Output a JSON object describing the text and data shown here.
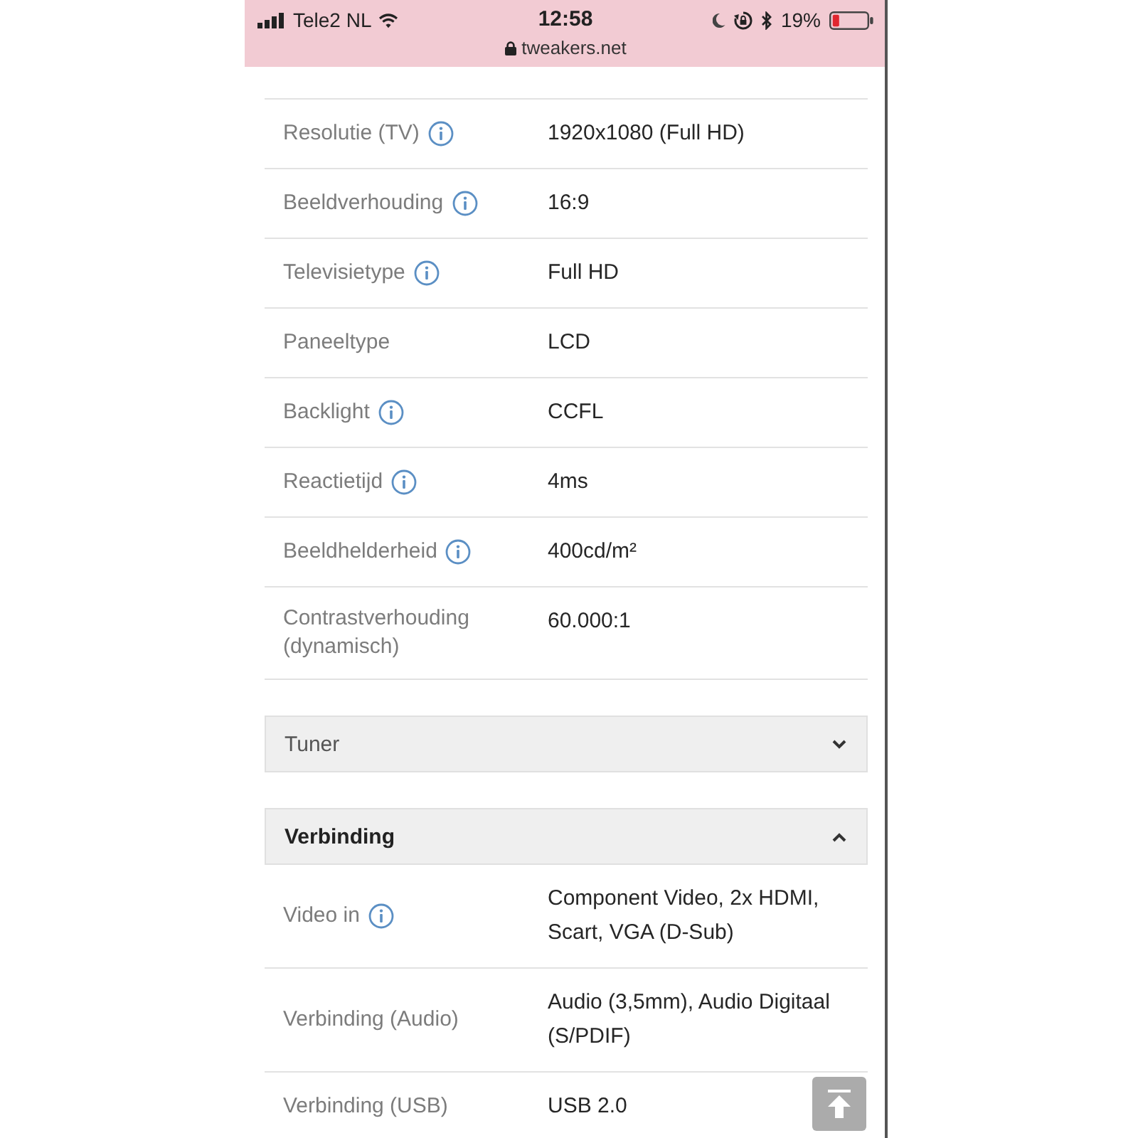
{
  "status_bar": {
    "carrier": "Tele2 NL",
    "time": "12:58",
    "url": "tweakers.net",
    "battery": "19%"
  },
  "specs": [
    {
      "label": "Resolutie (TV)",
      "info": true,
      "value": "1920x1080 (Full HD)"
    },
    {
      "label": "Beeldverhouding",
      "info": true,
      "value": "16:9"
    },
    {
      "label": "Televisietype",
      "info": true,
      "value": "Full HD"
    },
    {
      "label": "Paneeltype",
      "info": false,
      "value": "LCD"
    },
    {
      "label": "Backlight",
      "info": true,
      "value": "CCFL"
    },
    {
      "label": "Reactietijd",
      "info": true,
      "value": "4ms"
    },
    {
      "label": "Beeldhelderheid",
      "info": true,
      "value": "400cd/m²"
    },
    {
      "label": "Contrastverhouding (dynamisch)",
      "info": false,
      "value": "60.000:1"
    }
  ],
  "sections": [
    {
      "title": "Tuner",
      "expanded": false
    },
    {
      "title": "Verbinding",
      "expanded": true,
      "rows": [
        {
          "label": "Video in",
          "info": true,
          "value": "Component Video, 2x HDMI, Scart, VGA (D-Sub)"
        },
        {
          "label": "Verbinding (Audio)",
          "info": false,
          "value": "Audio (3,5mm), Audio Digitaal (S/PDIF)"
        },
        {
          "label": "Verbinding (USB)",
          "info": false,
          "value": "USB 2.0"
        }
      ]
    }
  ]
}
